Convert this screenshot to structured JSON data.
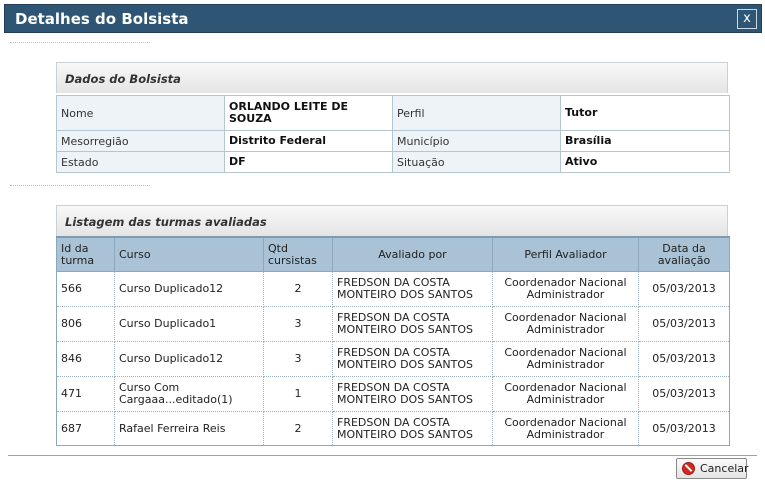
{
  "dialog": {
    "title": "Detalhes do Bolsista",
    "close_label": "x"
  },
  "bolsista": {
    "section_title": "Dados do Bolsista",
    "nome_label": "Nome",
    "nome_value": "ORLANDO LEITE DE SOUZA",
    "perfil_label": "Perfil",
    "perfil_value": "Tutor",
    "mesorregiao_label": "Mesorregião",
    "mesorregiao_value": "Distrito Federal",
    "municipio_label": "Município",
    "municipio_value": "Brasília",
    "estado_label": "Estado",
    "estado_value": "DF",
    "situacao_label": "Situação",
    "situacao_value": "Ativo"
  },
  "turmas": {
    "section_title": "Listagem das turmas avaliadas",
    "columns": [
      "Id da turma",
      "Curso",
      "Qtd cursistas",
      "Avaliado por",
      "Perfil Avaliador",
      "Data da avaliação"
    ],
    "rows": [
      [
        "566",
        "Curso Duplicado12",
        "2",
        "FREDSON DA COSTA MONTEIRO DOS SANTOS",
        "Coordenador Nacional Administrador",
        "05/03/2013"
      ],
      [
        "806",
        "Curso Duplicado1",
        "3",
        "FREDSON DA COSTA MONTEIRO DOS SANTOS",
        "Coordenador Nacional Administrador",
        "05/03/2013"
      ],
      [
        "846",
        "Curso Duplicado12",
        "3",
        "FREDSON DA COSTA MONTEIRO DOS SANTOS",
        "Coordenador Nacional Administrador",
        "05/03/2013"
      ],
      [
        "471",
        "Curso Com Cargaaa...editado(1)",
        "1",
        "FREDSON DA COSTA MONTEIRO DOS SANTOS",
        "Coordenador Nacional Administrador",
        "05/03/2013"
      ],
      [
        "687",
        "Rafael Ferreira Reis",
        "2",
        "FREDSON DA COSTA MONTEIRO DOS SANTOS",
        "Coordenador Nacional Administrador",
        "05/03/2013"
      ]
    ]
  },
  "footer": {
    "cancel_label": "Cancelar",
    "cancel_icon": "cancel-icon"
  }
}
